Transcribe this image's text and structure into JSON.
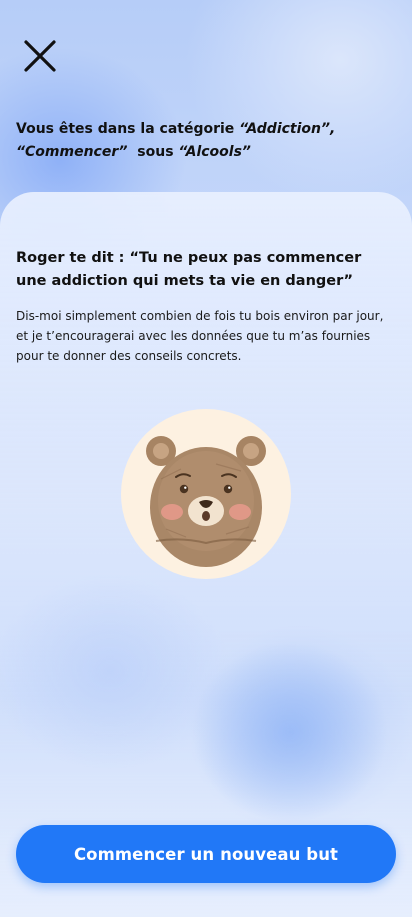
{
  "header": {
    "close_icon": "close-icon",
    "category_prefix": "Vous êtes dans la catégorie ",
    "category_name": "“Addiction”,",
    "category_action": "“Commencer”",
    "category_sous": "  sous ",
    "category_sub": "“Alcools”"
  },
  "main": {
    "quote_title": "Roger te dit : “Tu ne peux pas commencer une addiction qui mets ta vie en danger”",
    "quote_body": "Dis-moi simplement combien de fois tu bois environ par jour, et je t’encouragerai avec les données que tu m’as fournies pour te donner des conseils concrets.",
    "mascot": "bear-mascot",
    "mascot_bg_color": "#fdf1e1"
  },
  "footer": {
    "cta_label": "Commencer un nouveau but",
    "cta_color": "#2178f7"
  }
}
